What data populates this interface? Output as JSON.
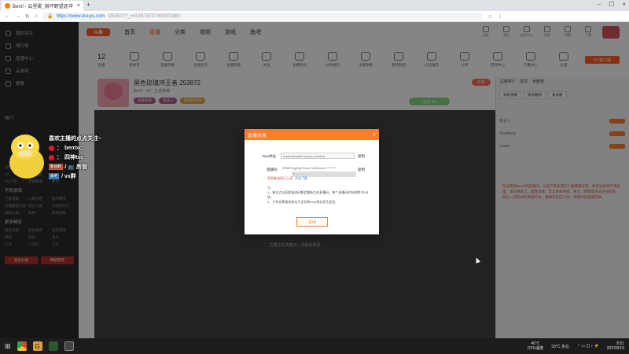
{
  "browser": {
    "tab_title": "Bent! - 云里雾_崩坏野望逐冲",
    "url_host": "https://www.douyu.com",
    "url_path": "/253872?_r=0.8474737404371880",
    "new_tab": "+"
  },
  "site": {
    "logo": "斗鱼",
    "nav": [
      "首页",
      "直播",
      "分类",
      "视频",
      "游戏",
      "鱼吧"
    ],
    "top_icons": [
      "历史",
      "关注",
      "创作中心",
      "消息",
      "充值",
      "下载"
    ],
    "count": "12",
    "categories": [
      "主播",
      "看榜单",
      "直播开播",
      "主播任务",
      "主播频道",
      "关注",
      "主播时光",
      "分享福利",
      "主播攻略",
      "我的频道",
      "小说推荐",
      "公布",
      "游戏中心",
      "下载中心",
      "主题",
      "PK",
      "设置"
    ],
    "pc_button": "PC客户端"
  },
  "left_nav": {
    "items": [
      "我的关注",
      "排行榜",
      "直播中心",
      "云游戏",
      "赛事"
    ],
    "section_hot": "热门",
    "grid1": [
      "分区",
      "DOTA2",
      "王者荣耀",
      "CF",
      "和平精英",
      "LOL",
      "QQ飞车",
      "英雄联盟",
      "原神",
      "星际争霸",
      "火影忍者",
      "三国杀"
    ],
    "section_mobile": "手机游戏",
    "grid2": [
      "王者荣耀",
      "火影忍者",
      "和平精英",
      "英雄联盟手游",
      "第五人格",
      "天涯明月刀",
      "穿越火线",
      "原神",
      "使命召唤"
    ],
    "section_more": "更多精彩",
    "grid3": [
      "娱乐天地",
      "科技教育",
      "主机游戏",
      "颜值",
      "美食",
      "音乐",
      "户外",
      "二次元",
      "汽车"
    ],
    "bottom": [
      "鱼乐分类",
      "网络游戏"
    ]
  },
  "streamer": {
    "name": "黑色玫瑰冲王者 253872",
    "meta": "Bent! · 20 · 王者荣耀",
    "report": "举报",
    "tags": [
      "主播等级",
      "贵族 1",
      "超级粉丝团"
    ],
    "follow": "关注 99"
  },
  "right_panel": {
    "tabs": [
      "主播排行",
      "贵宾",
      "贡献榜"
    ],
    "chips": [
      "本场贡献",
      "周贡献榜",
      "总贡献"
    ],
    "rows": [
      "粉丝 1",
      "Skadibug",
      "Linger"
    ],
    "notice": "欢迎来到Bent!的直播间，斗鱼严禁未成年人直播或打赏。如有违规将严肃处理，请文明发言，理性消费。禁止发布色情、暴力、赌博等违法违规内容，禁止一切形式的刷屏行为。请遵守社区公约，共建绿色直播环境。"
  },
  "video": {
    "caption": "主播正在准备中，请稍后观看"
  },
  "overlay": {
    "headline": "喜欢主播的点点关注~",
    "line1_name": "bentxc",
    "line2_name": "四神txc",
    "line3_tag1": "粉丝群",
    "line3_text": "/ 📺 房管",
    "line4_tag": "鱼吧",
    "line4_text": "/ vx群"
  },
  "modal": {
    "title": "直播信息",
    "close": "×",
    "rtmp_label": "rtmp地址:",
    "rtmp_value": "rtmp://sendtc3.douyu.com/live",
    "key_label": "直播码:",
    "key_value": "253872rgjHgCSUvuTvsSecret=********",
    "copy": "复制",
    "select_value": "• ……………",
    "warn": "您的推流码已上线",
    "warn_link": "点击了解",
    "notes_title": "注：",
    "notes": [
      "1、每次点击获取推流码都会重新生成直播码，每个直播码的有效期为5分钟。",
      "2、只有切换推流地址才会导致rtmp地址发生变化。"
    ],
    "ok": "关闭"
  },
  "taskbar": {
    "temp": "40°C",
    "cpu": "CPU温度",
    "weather": "33°C 多云",
    "time": "8:51",
    "date": "2022/8/19"
  },
  "colors": {
    "accent": "#ff7d2d",
    "brand": "#ff5d23"
  }
}
